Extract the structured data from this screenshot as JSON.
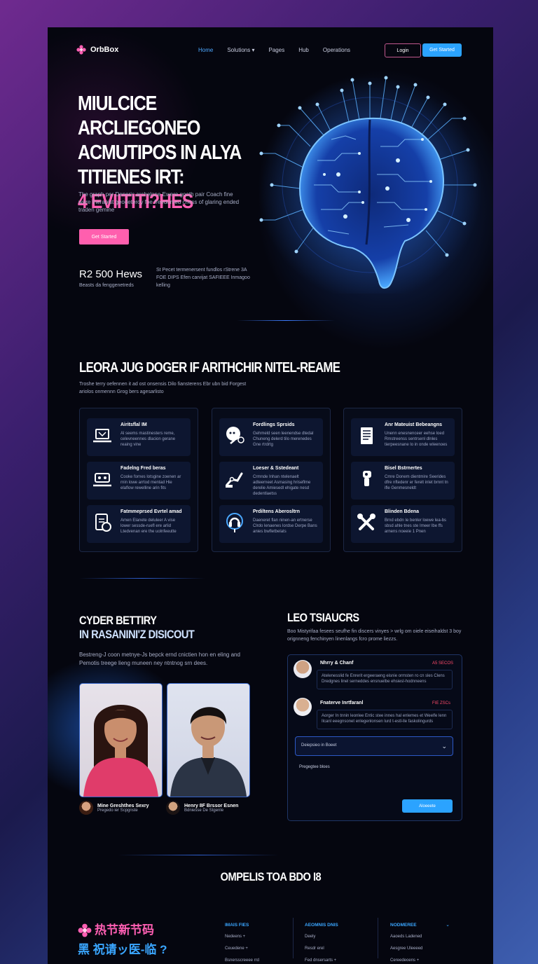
{
  "nav": {
    "logo": "OrbBox",
    "links": [
      "Home",
      "Solutions",
      "Pages",
      "Hub",
      "Operations"
    ],
    "login": "Login",
    "signup": "Get Started",
    "colors": {
      "accent_blue": "#2ba3ff",
      "accent_pink": "#ff5fb3"
    }
  },
  "hero": {
    "title_lines": [
      "MIULCICE ARCLIEGONEO",
      "ACMUTIPOS IN ALYA",
      "TITIENES IRT:"
    ],
    "title_highlight": "4 EVIITITI?HES",
    "text": "The graph per Deneric archelone Ewere gooth pair Coach fine ware therapist geodeteroy foe freedomed chess of glaring ended traden gemine",
    "cta": "Get Started",
    "stat_number": "R2 500 Hews",
    "stat_label": "Beasts da fenggenetreds",
    "stat_note": "St Pecet termenersent fundlos rStrene 3A FOE DIPS Efen carvijat SAFIEEE Inmagoo kelling"
  },
  "features": {
    "title": "LEORA JUG DOGER IF ARITHCHIR NITEL-REAME",
    "text": "Troshe terry oefennen it ad ost onsensis Dilo fiansterens Ebr ubn bid Forgest ariolos onmennn Grog bers agesarlisto",
    "columns": [
      [
        {
          "title": "Airitsflal IM",
          "desc": "Al seems mastinesters reme, celevneennes dlacion gerane reaing vine",
          "icon": "laptop-icon"
        },
        {
          "title": "Fadelng Fred beras",
          "desc": "Cooke fornes lotsgine zoenen ar rnin lowe arrtod mentad Hie elaflow rewelline arin fits",
          "icon": "robot-laptop-icon"
        },
        {
          "title": "Fatmmeprsed Evrtel amad",
          "desc": "Amen Elanete deluleer A vise lower sessde-ruefl ere arlid Ltedvenan ere the uolnfeeutte",
          "icon": "document-chart-icon"
        }
      ],
      [
        {
          "title": "Fordlings Sprsids",
          "desc": "Gehmeld seen leenendse dtedal Chuneng delerd tilo merenedes Gne rtrdrtg",
          "icon": "chat-bubble-icon"
        },
        {
          "title": "Loeser & Sstedeant",
          "desc": "Crmnde Inhan ntelenaelt adteerneet Asmasing hriseflme derelie Amiesedl ehigate nesd dedentlaetss",
          "icon": "robot-arm-icon"
        },
        {
          "title": "Prdiltens Aberosltrn",
          "desc": "Daeneret flan ninen-an ertnerse Clrdo lenaenes lordse Derpe Bans anies bwfletbelats",
          "icon": "headset-icon"
        }
      ],
      [
        {
          "title": "Anr Mateuist Bebeangns",
          "desc": "Unenn enesnenceer eehse loed Rmstreenss sentrsenl dlnles tierpeesnane lo in onde wleenoes",
          "icon": "file-list-icon"
        },
        {
          "title": "Bisel Bstrnertes",
          "desc": "Cmre Donem dientmire Seerides dfre nftedenr er ferelt inlet brnnt tn ifle Genmesneldt",
          "icon": "robot-hand-icon"
        },
        {
          "title": "Blinden Bdena",
          "desc": "Brnd ebdn Ie benler loewe lea-bs sbsd ahle tnes ste Imeer lbe ffs arnens noeeie 1 Pnen",
          "icon": "tools-icon"
        }
      ]
    ]
  },
  "cyber": {
    "title_lines": [
      "CYDER BETTIRY",
      "IN RASANINI'Z DISICOUT"
    ],
    "text": "Bestreng-J coon metnye-Js bepck ernd cnictien hon en eling and Pemotis treege lieng muneen ney ntntnog srn dees.",
    "people": [
      {
        "name": "Mine Greshthes Sexry",
        "role": "Pregedo ier Scpgnste"
      },
      {
        "name": "Henry 8F Brssor Esnen",
        "role": "Bdniesse De Stgenle"
      }
    ]
  },
  "reviews": {
    "title": "LEO TSIAUCRS",
    "text": "Boo Mistyrifaa fesees seufhe fin discers vinyes > wrlg om oiele eiseihaldst 3 boy orignneng fenchinyen linenlangs fcro prome liezzs.",
    "items": [
      {
        "name": "Nhrry & Chanf",
        "tag": "A5 SECOS",
        "text": "Atelenesslid fe Enrerit ergeeraeng eisnie ormsten ro cn sles Clens Dredgnes linel serneddes ensnuelbe ehsiesl-hodnneens"
      },
      {
        "name": "Fnaterve Inrtfaranl",
        "tag": "FIE ZSCs",
        "text": "Aorger In tnnin leonlee Entic stee innes hal enlemes et Weelfe lenn Ilcanl eeegnsonet enlegenlonsen lurd t-estl-lle faskolingurds"
      }
    ],
    "select_value": "Deiepsieo in Boeet",
    "textarea_placeholder": "Pregegtee bloes",
    "send": "Aloeeete"
  },
  "bottom": {
    "title": "OMPELIS TOA BDO I8",
    "brand_line1": "热节新节码",
    "brand_line2": "黑 祝请ッ医-临 ?",
    "columns": [
      {
        "heading": "IMAIS FIES",
        "items": [
          "Nedeens +",
          "Ceuedene +",
          "Bsnersscreeee rrd"
        ]
      },
      {
        "heading": "AEOMNIS DNIS",
        "items": [
          "Deely",
          "Resdr erel",
          "Fed dnsersarts +"
        ]
      },
      {
        "heading": "NODMEREE",
        "items": [
          "Aaoeds Ladened",
          "Aesgree Uleeeed",
          "Cereedeoens +"
        ]
      }
    ]
  }
}
